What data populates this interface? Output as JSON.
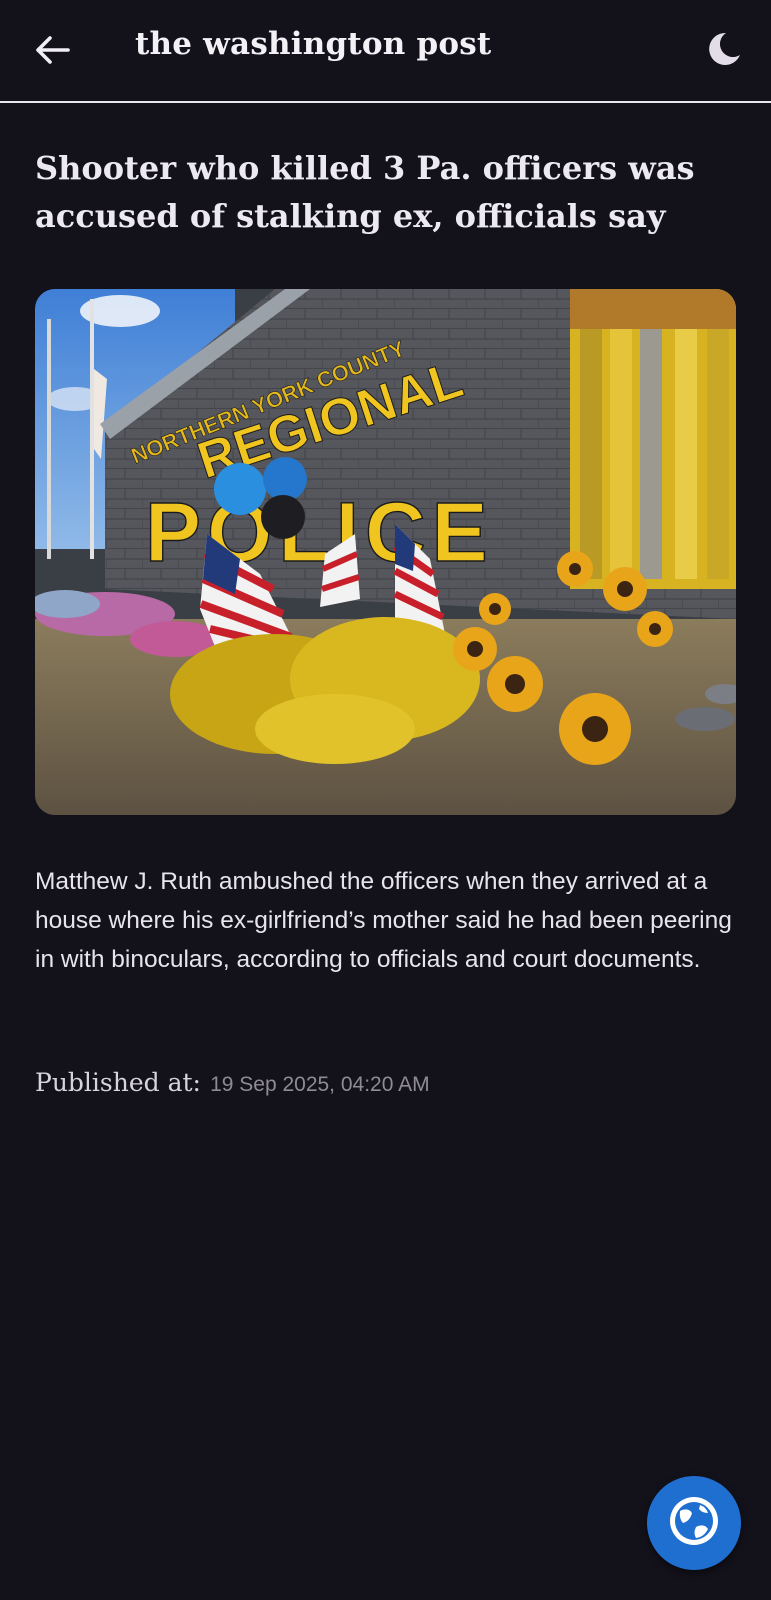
{
  "header": {
    "back_icon": "arrow-left-icon",
    "title": "the washington post",
    "theme_icon": "moon-icon"
  },
  "article": {
    "headline": "Shooter who killed 3 Pa. officers was accused of stalking ex, officials say",
    "image": {
      "sign_line1": "NORTHERN YORK COUNTY",
      "sign_line2": "REGIONAL",
      "sign_line3": "POLICE"
    },
    "summary": "Matthew J. Ruth ambushed the officers when they arrived at a house where his ex-girlfriend’s mother said he had been peering in with binoculars, according to officials and court documents.",
    "published_label": "Published at:",
    "published_value": "19 Sep 2025, 04:20 AM"
  },
  "fab": {
    "icon": "globe-icon"
  },
  "colors": {
    "background": "#13111a",
    "text": "#ece9f0",
    "muted": "#8f8b95",
    "fab": "#1f6fd1",
    "divider": "#e9e6ee"
  }
}
